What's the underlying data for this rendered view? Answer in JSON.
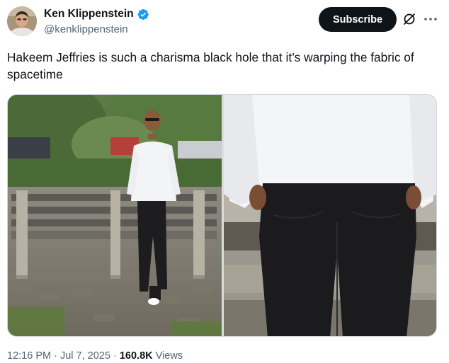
{
  "author": {
    "display_name": "Ken Klippenstein",
    "handle": "@kenklippenstein",
    "verified": true,
    "verified_color": "#1d9bf0"
  },
  "actions": {
    "subscribe_label": "Subscribe",
    "icons": [
      "grok-icon",
      "more-icon"
    ]
  },
  "tweet": {
    "text": "Hakeem Jeffries is such a charisma black hole that it’s warping the fabric of spacetime"
  },
  "media": {
    "count": 2
  },
  "meta": {
    "time": "12:16 PM",
    "separator": "·",
    "date": "Jul 7, 2025",
    "views_count": "160.8K",
    "views_label": "Views"
  }
}
